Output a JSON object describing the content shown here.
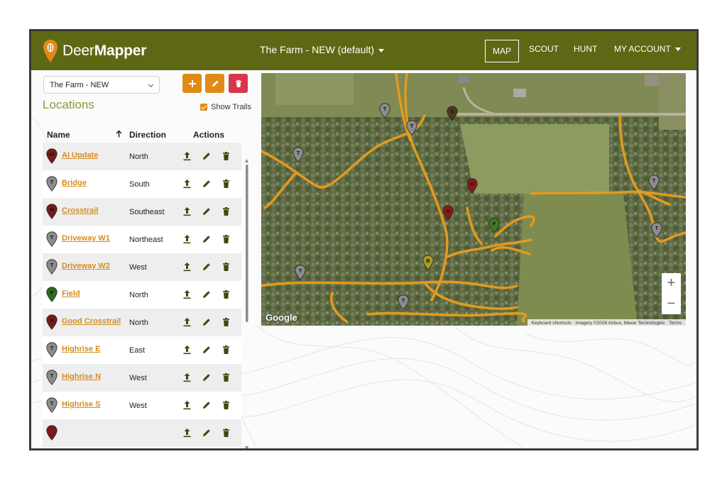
{
  "header": {
    "brand_light": "Deer",
    "brand_bold": "Mapper",
    "farm_selector": "The Farm - NEW (default)",
    "nav": [
      {
        "label": "MAP",
        "active": true
      },
      {
        "label": "SCOUT",
        "active": false
      },
      {
        "label": "HUNT",
        "active": false
      },
      {
        "label": "MY ACCOUNT",
        "active": false
      }
    ],
    "bar_color": "#5e6814"
  },
  "sidebar": {
    "property_select": "The Farm - NEW",
    "buttons": [
      {
        "name": "add-button",
        "icon": "plus-icon",
        "color": "#e08a17"
      },
      {
        "name": "edit-button",
        "icon": "pencil-icon",
        "color": "#e08a17"
      },
      {
        "name": "delete-button",
        "icon": "trash-icon",
        "color": "#d9364a"
      }
    ],
    "title": "Locations",
    "show_trails_label": "Show Trails",
    "show_trails_checked": true,
    "columns": {
      "name": "Name",
      "direction": "Direction",
      "actions": "Actions"
    },
    "rows": [
      {
        "name": "AI Update",
        "direction": "North",
        "letter": "H",
        "color": "#7a1a1a"
      },
      {
        "name": "Bridge",
        "direction": "South",
        "letter": "T",
        "color": "#8c8c8c"
      },
      {
        "name": "Crosstrail",
        "direction": "Southeast",
        "letter": "H",
        "color": "#7a1a1a"
      },
      {
        "name": "Driveway W1",
        "direction": "Northeast",
        "letter": "T",
        "color": "#8c8c8c"
      },
      {
        "name": "Driveway W2",
        "direction": "West",
        "letter": "T",
        "color": "#8c8c8c"
      },
      {
        "name": "Field",
        "direction": "North",
        "letter": "F",
        "color": "#2e6b1e"
      },
      {
        "name": "Good Crosstrail",
        "direction": "North",
        "letter": "H",
        "color": "#7a1a1a"
      },
      {
        "name": "Highrise E",
        "direction": "East",
        "letter": "T",
        "color": "#8c8c8c"
      },
      {
        "name": "Highrise N",
        "direction": "West",
        "letter": "T",
        "color": "#8c8c8c"
      },
      {
        "name": "Highrise S",
        "direction": "West",
        "letter": "T",
        "color": "#8c8c8c"
      },
      {
        "name": "",
        "direction": "",
        "letter": "",
        "color": "#7a1a1a"
      }
    ]
  },
  "map": {
    "logo": "Google",
    "attribution": [
      "Keyboard shortcuts",
      "Imagery ©2026 Airbus, Maxar Technologies",
      "Terms"
    ],
    "zoom_in": "+",
    "zoom_out": "−",
    "markers": [
      {
        "letter": "T",
        "color": "#8c8c8c"
      },
      {
        "letter": "T",
        "color": "#8c8c8c"
      },
      {
        "letter": "S",
        "color": "#4a3a1c"
      },
      {
        "letter": "T",
        "color": "#8c8c8c"
      },
      {
        "letter": "H",
        "color": "#8a1a1a"
      },
      {
        "letter": "H",
        "color": "#8a1a1a"
      },
      {
        "letter": "F",
        "color": "#3f7a22"
      },
      {
        "letter": "T",
        "color": "#8c8c8c"
      },
      {
        "letter": "T",
        "color": "#8c8c8c"
      },
      {
        "letter": "B",
        "color": "#a99a2a"
      },
      {
        "letter": "T",
        "color": "#8c8c8c"
      },
      {
        "letter": "T",
        "color": "#8c8c8c"
      }
    ],
    "trail_color": "#e39a1f"
  }
}
